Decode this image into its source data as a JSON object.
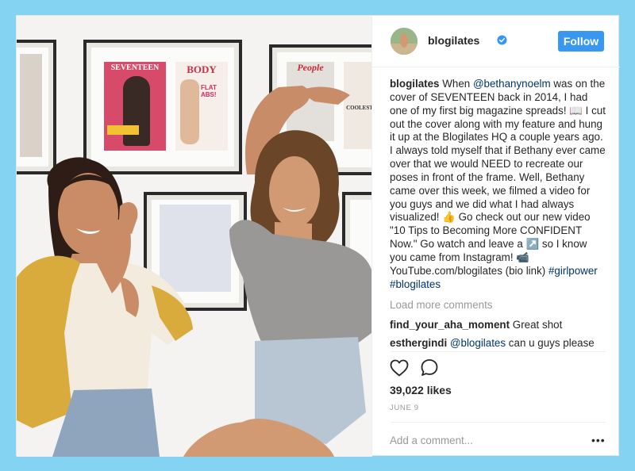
{
  "post": {
    "username": "blogilates",
    "follow_label": "Follow",
    "caption": {
      "author": "blogilates",
      "part1": " When ",
      "mention1": "@bethanynoelm",
      "part2": " was on the cover of SEVENTEEN back in 2014, I had one of my first big magazine spreads! 📖 I cut out the cover along with my feature and hung it up at the Blogilates HQ a couple years ago. I always told myself that if Bethany ever came over that we would NEED to recreate our poses in front of the frame. Well, Bethany came over this week, we filmed a video for you guys and we did what I had always visualized! 👍 Go check out our new video \"10 Tips to Becoming More CONFIDENT Now.\" Go watch and leave a ↗️ so I know you came from Instagram! 📹 YouTube.com/blogilates (bio link) ",
      "tag1": "#girlpower",
      "space": " ",
      "tag2": "#blogilates"
    },
    "load_more": "Load more comments",
    "comments": [
      {
        "user": "find_your_aha_moment",
        "text": " Great shot"
      },
      {
        "user": "esthergindi",
        "mention": "@blogilates",
        "text": " can u guys please"
      }
    ],
    "likes": "39,022 likes",
    "date": "JUNE 9",
    "add_comment_placeholder": "Add a comment...",
    "more_label": "•••",
    "icons": {
      "like": "heart-icon",
      "comment": "comment-bubble-icon",
      "verified": "verified-badge-icon"
    },
    "colors": {
      "background": "#85d3f3",
      "follow": "#3897f0",
      "mention": "#003569",
      "muted": "#999999"
    }
  },
  "photo": {
    "magazines": [
      {
        "title": "SEVENTEEN"
      },
      {
        "title": "BODY",
        "subtitle": "FLAT ABS!"
      },
      {
        "title": "People"
      },
      {
        "title": "COOLEST"
      }
    ]
  }
}
